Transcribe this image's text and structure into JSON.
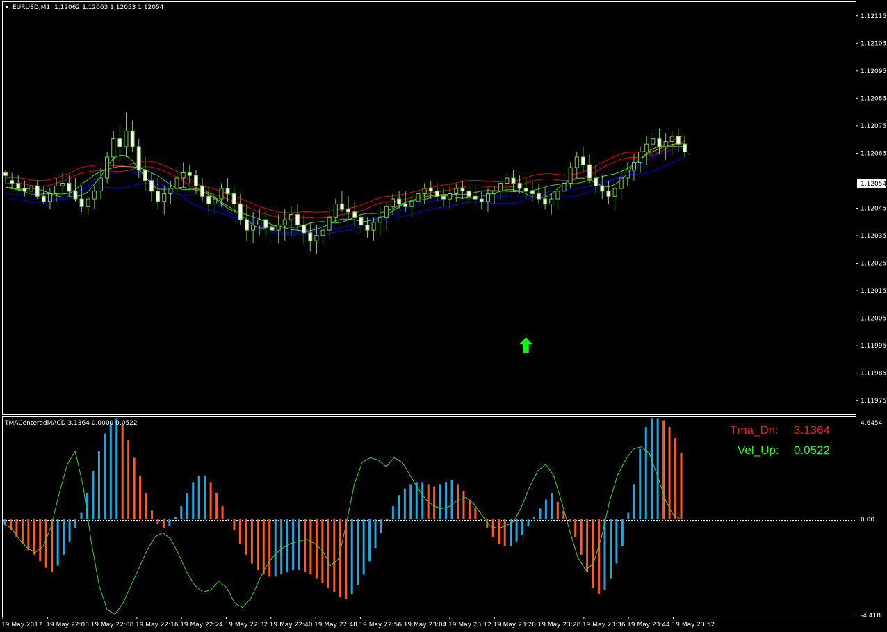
{
  "header": {
    "symbol_label": "EURUSD,M1",
    "ohlc_label": "1.12062 1.12063 1.12053 1.12054"
  },
  "indicator": {
    "label": "TMACenteredMACD 3.1364 0.0000 0.0522",
    "tma_dn_label": "Tma_Dn:",
    "tma_dn_value": "3.1364",
    "vel_up_label": "Vel_Up:",
    "vel_up_value": "0.0522"
  },
  "colors": {
    "background": "#000000",
    "frame": "#ffffff",
    "candle": "#7bd13a",
    "candle_bull_fill": "#000000",
    "candle_bear_fill": "#ffffff",
    "tma_red": "#e00000",
    "tma_blue": "#0000e0",
    "tma_green": "#49d02f",
    "hist_up": "#1fa7e0",
    "hist_dn": "#ff5a1f",
    "signal_line": "#49d02f",
    "arrow": "#00ff00",
    "tma_dn_text": "#ff1a1a",
    "vel_up_text": "#1dff1d",
    "zero_line": "#ffffff"
  },
  "chart_data": [
    {
      "type": "candlestick",
      "title": "EURUSD,M1",
      "y_ticks": [
        "1.12115",
        "1.12105",
        "1.12095",
        "1.12085",
        "1.12075",
        "1.12065",
        "1.12054",
        "1.12045",
        "1.12035",
        "1.12025",
        "1.12015",
        "1.12005",
        "1.11995",
        "1.11985",
        "1.11975"
      ],
      "current_price": "1.12054",
      "ylim": [
        1.1197,
        1.1212
      ],
      "x_ticks": [
        "19 May 2017",
        "19 May 22:00",
        "19 May 22:08",
        "19 May 22:16",
        "19 May 22:24",
        "19 May 22:32",
        "19 May 22:40",
        "19 May 22:48",
        "19 May 22:56",
        "19 May 23:04",
        "19 May 23:12",
        "19 May 23:20",
        "19 May 23:28",
        "19 May 23:36",
        "19 May 23:44",
        "19 May 23:52"
      ],
      "anchor_price": 1.12056,
      "deltas": [
        [
          2,
          3,
          -2,
          1
        ],
        [
          -1,
          2,
          -4,
          -2
        ],
        [
          -2,
          1,
          -5,
          -4
        ],
        [
          -4,
          -1,
          -7,
          -5
        ],
        [
          -5,
          -2,
          -8,
          -3
        ],
        [
          -3,
          -1,
          -8,
          -7
        ],
        [
          -7,
          -3,
          -10,
          -9
        ],
        [
          -9,
          -4,
          -12,
          -6
        ],
        [
          -6,
          0,
          -9,
          -3
        ],
        [
          -3,
          2,
          -6,
          -2
        ],
        [
          -2,
          1,
          -7,
          -5
        ],
        [
          -5,
          0,
          -9,
          -8
        ],
        [
          -8,
          -3,
          -13,
          -11
        ],
        [
          -11,
          -7,
          -14,
          -8
        ],
        [
          -8,
          -3,
          -12,
          -5
        ],
        [
          -5,
          4,
          -8,
          0
        ],
        [
          0,
          10,
          -2,
          8
        ],
        [
          8,
          18,
          4,
          15
        ],
        [
          15,
          20,
          6,
          12
        ],
        [
          12,
          25,
          8,
          18
        ],
        [
          18,
          22,
          10,
          12
        ],
        [
          12,
          15,
          0,
          3
        ],
        [
          3,
          8,
          -5,
          -1
        ],
        [
          -1,
          2,
          -9,
          -5
        ],
        [
          -5,
          0,
          -12,
          -9
        ],
        [
          -9,
          -3,
          -14,
          -6
        ],
        [
          -6,
          -1,
          -10,
          -4
        ],
        [
          -4,
          4,
          -7,
          0
        ],
        [
          0,
          6,
          -4,
          2
        ],
        [
          2,
          5,
          -2,
          1
        ],
        [
          1,
          3,
          -6,
          -3
        ],
        [
          -3,
          0,
          -9,
          -7
        ],
        [
          -7,
          -3,
          -13,
          -10
        ],
        [
          -10,
          -6,
          -14,
          -8
        ],
        [
          -8,
          -2,
          -11,
          -4
        ],
        [
          -4,
          0,
          -9,
          -6
        ],
        [
          -6,
          -3,
          -12,
          -10
        ],
        [
          -10,
          -6,
          -18,
          -16
        ],
        [
          -16,
          -10,
          -24,
          -20
        ],
        [
          -20,
          -13,
          -25,
          -18
        ],
        [
          -18,
          -12,
          -22,
          -16
        ],
        [
          -16,
          -12,
          -23,
          -19
        ],
        [
          -19,
          -15,
          -24,
          -20
        ],
        [
          -20,
          -14,
          -25,
          -18
        ],
        [
          -18,
          -12,
          -24,
          -16
        ],
        [
          -16,
          -11,
          -22,
          -14
        ],
        [
          -14,
          -10,
          -20,
          -18
        ],
        [
          -18,
          -14,
          -25,
          -21
        ],
        [
          -21,
          -17,
          -28,
          -24
        ],
        [
          -24,
          -18,
          -29,
          -22
        ],
        [
          -22,
          -16,
          -26,
          -20
        ],
        [
          -20,
          -12,
          -23,
          -15
        ],
        [
          -15,
          -8,
          -17,
          -10
        ],
        [
          -10,
          -5,
          -13,
          -12
        ],
        [
          -12,
          -7,
          -16,
          -13
        ],
        [
          -13,
          -9,
          -19,
          -15
        ],
        [
          -15,
          -12,
          -21,
          -18
        ],
        [
          -18,
          -15,
          -23,
          -20
        ],
        [
          -20,
          -15,
          -24,
          -17
        ],
        [
          -17,
          -11,
          -22,
          -15
        ],
        [
          -15,
          -9,
          -20,
          -11
        ],
        [
          -11,
          -6,
          -14,
          -8
        ],
        [
          -8,
          -5,
          -12,
          -10
        ],
        [
          -10,
          -5,
          -13,
          -11
        ],
        [
          -11,
          -6,
          -15,
          -9
        ],
        [
          -9,
          -4,
          -12,
          -6
        ],
        [
          -6,
          -2,
          -10,
          -4
        ],
        [
          -4,
          -1,
          -8,
          -5
        ],
        [
          -5,
          -2,
          -9,
          -7
        ],
        [
          -7,
          -4,
          -11,
          -8
        ],
        [
          -8,
          -3,
          -12,
          -6
        ],
        [
          -6,
          -2,
          -9,
          -4
        ],
        [
          -4,
          -1,
          -8,
          -5
        ],
        [
          -5,
          -2,
          -9,
          -7
        ],
        [
          -7,
          -3,
          -11,
          -8
        ],
        [
          -8,
          -5,
          -12,
          -9
        ],
        [
          -9,
          -4,
          -13,
          -6
        ],
        [
          -6,
          -3,
          -10,
          -5
        ],
        [
          -5,
          -1,
          -8,
          -2
        ],
        [
          -2,
          2,
          -6,
          0
        ],
        [
          0,
          3,
          -5,
          -2
        ],
        [
          -2,
          1,
          -6,
          -4
        ],
        [
          -4,
          0,
          -8,
          -5
        ],
        [
          -5,
          -1,
          -9,
          -6
        ],
        [
          -6,
          -2,
          -10,
          -8
        ],
        [
          -8,
          -4,
          -12,
          -10
        ],
        [
          -10,
          -6,
          -14,
          -8
        ],
        [
          -8,
          -3,
          -12,
          -5
        ],
        [
          -5,
          1,
          -8,
          -2
        ],
        [
          -2,
          6,
          -4,
          4
        ],
        [
          4,
          10,
          0,
          8
        ],
        [
          8,
          12,
          2,
          5
        ],
        [
          5,
          9,
          -2,
          0
        ],
        [
          0,
          5,
          -6,
          -3
        ],
        [
          -3,
          1,
          -8,
          -5
        ],
        [
          -5,
          -1,
          -10,
          -7
        ],
        [
          -7,
          -2,
          -12,
          -4
        ],
        [
          -4,
          2,
          -8,
          0
        ],
        [
          0,
          6,
          -3,
          3
        ],
        [
          3,
          9,
          -1,
          6
        ],
        [
          6,
          12,
          2,
          10
        ],
        [
          10,
          16,
          5,
          13
        ],
        [
          13,
          18,
          8,
          15
        ],
        [
          15,
          19,
          9,
          12
        ],
        [
          12,
          17,
          7,
          14
        ],
        [
          14,
          18,
          9,
          16
        ],
        [
          16,
          19,
          10,
          13
        ],
        [
          13,
          16,
          8,
          10
        ]
      ]
    },
    {
      "type": "bar",
      "title": "TMACenteredMACD 3.1364 0.0000 0.0522",
      "y_ticks": [
        "4.6454",
        "0.00",
        "-4.418"
      ],
      "ylim": [
        -4.418,
        4.6454
      ],
      "histogram": [
        -0.2,
        -0.5,
        -0.8,
        -1.1,
        -1.4,
        -1.6,
        -1.9,
        -2.2,
        -2.4,
        -2.1,
        -1.6,
        -1.0,
        -0.4,
        0.3,
        1.2,
        2.2,
        3.1,
        3.9,
        4.4,
        4.6,
        4.3,
        3.6,
        2.8,
        2.0,
        1.2,
        0.4,
        -0.2,
        -0.4,
        -0.3,
        0.1,
        0.6,
        1.2,
        1.7,
        2.0,
        2.0,
        1.7,
        1.2,
        0.6,
        0.0,
        -0.5,
        -1.1,
        -1.6,
        -2.0,
        -2.3,
        -2.5,
        -2.6,
        -2.6,
        -2.5,
        -2.4,
        -2.3,
        -2.3,
        -2.4,
        -2.5,
        -2.7,
        -2.9,
        -3.1,
        -3.3,
        -3.5,
        -3.6,
        -3.4,
        -3.0,
        -2.5,
        -1.9,
        -1.3,
        -0.6,
        0.0,
        0.6,
        1.1,
        1.4,
        1.6,
        1.7,
        1.7,
        1.6,
        1.5,
        1.6,
        1.7,
        1.8,
        1.6,
        1.3,
        0.9,
        0.5,
        0.0,
        -0.4,
        -0.8,
        -1.1,
        -1.2,
        -1.2,
        -1.0,
        -0.7,
        -0.3,
        0.1,
        0.5,
        0.9,
        1.2,
        0.8,
        0.4,
        -0.1,
        -0.8,
        -1.6,
        -2.4,
        -3.1,
        -3.4,
        -3.2,
        -2.7,
        -2.0,
        -1.2,
        0.3,
        1.6,
        3.2,
        4.2,
        4.6,
        4.6,
        4.5,
        4.2,
        3.7,
        3.0
      ],
      "hist_colors": "up when rising, down when falling",
      "signal": [
        -0.2,
        -0.4,
        -0.9,
        -1.3,
        -1.5,
        -1.2,
        -0.3,
        1.2,
        2.5,
        3.1,
        1.5,
        -1.0,
        -3.0,
        -4.1,
        -4.3,
        -3.8,
        -3.0,
        -2.2,
        -1.4,
        -0.8,
        -0.6,
        -0.9,
        -1.6,
        -2.4,
        -3.0,
        -3.3,
        -3.2,
        -2.8,
        -3.1,
        -3.8,
        -4.0,
        -3.6,
        -2.8,
        -2.1,
        -1.6,
        -1.3,
        -1.1,
        -1.0,
        -0.9,
        -1.1,
        -1.4,
        -2.1,
        -1.8,
        -0.2,
        1.6,
        2.6,
        2.8,
        2.7,
        2.4,
        2.8,
        2.6,
        2.0,
        1.4,
        0.9,
        0.6,
        0.5,
        0.6,
        0.9,
        1.0,
        0.7,
        0.2,
        -0.3,
        -0.4,
        -0.3,
        -0.1,
        0.6,
        1.5,
        2.2,
        2.5,
        2.0,
        0.8,
        -0.5,
        -1.7,
        -2.3,
        -2.0,
        -0.8,
        0.8,
        2.0,
        2.7,
        3.2,
        3.3,
        3.0,
        2.0,
        0.9,
        0.2,
        0.0
      ]
    }
  ],
  "signals": [
    {
      "type": "buy-arrow",
      "bar_index": 82
    }
  ]
}
